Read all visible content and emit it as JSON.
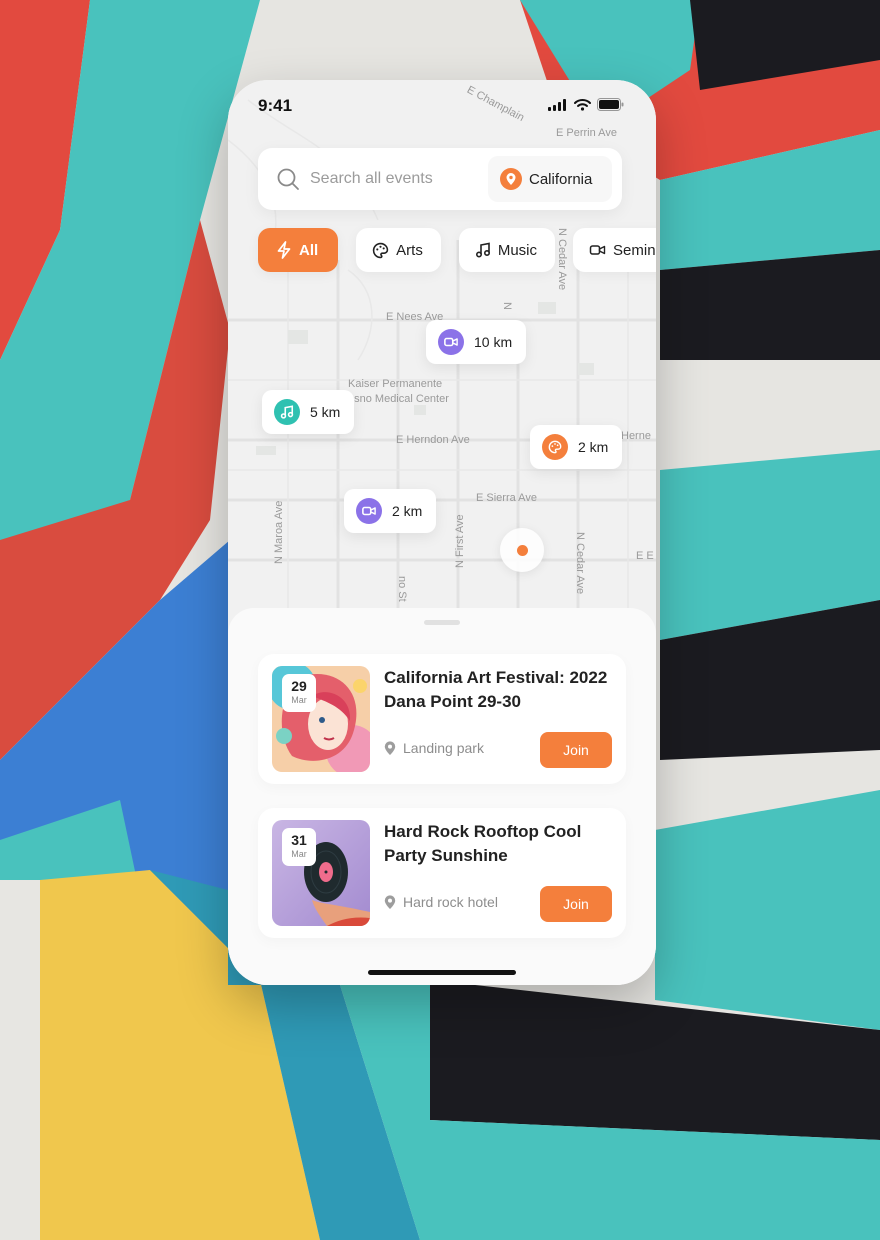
{
  "status_bar": {
    "time": "9:41"
  },
  "search": {
    "placeholder": "Search all events",
    "location": "California"
  },
  "filters": [
    {
      "label": "All",
      "icon": "lightning-icon",
      "active": true
    },
    {
      "label": "Arts",
      "icon": "palette-icon",
      "active": false
    },
    {
      "label": "Music",
      "icon": "music-note-icon",
      "active": false
    },
    {
      "label": "Seminar",
      "icon": "video-icon",
      "active": false
    }
  ],
  "map": {
    "street_labels": [
      "E Champlain",
      "E Perrin Ave",
      "E Nees Ave",
      "Kaiser Permanente",
      "esno Medical Center",
      "E Herndon Ave",
      "Herne",
      "E Sierra Ave",
      "N Maroa Ave",
      "N First Ave",
      "N Cedar Ave",
      "N Cedar Ave",
      "no St",
      "N",
      "E E"
    ],
    "markers": [
      {
        "distance": "10 km",
        "icon": "video-icon",
        "color": "#8b72e8"
      },
      {
        "distance": "5 km",
        "icon": "music-note-icon",
        "color": "#2fc1b1"
      },
      {
        "distance": "2 km",
        "icon": "palette-icon",
        "color": "#f47f3c"
      },
      {
        "distance": "2 km",
        "icon": "video-icon",
        "color": "#8b72e8"
      }
    ]
  },
  "events": [
    {
      "day": "29",
      "month": "Mar",
      "title": "California Art Festival: 2022 Dana Point 29-30",
      "location": "Landing park",
      "action": "Join"
    },
    {
      "day": "31",
      "month": "Mar",
      "title": "Hard Rock Rooftop Cool Party Sunshine",
      "location": "Hard rock hotel",
      "action": "Join"
    }
  ],
  "colors": {
    "accent": "#f47f3c",
    "teal": "#2fc1b1",
    "purple": "#8b72e8"
  }
}
